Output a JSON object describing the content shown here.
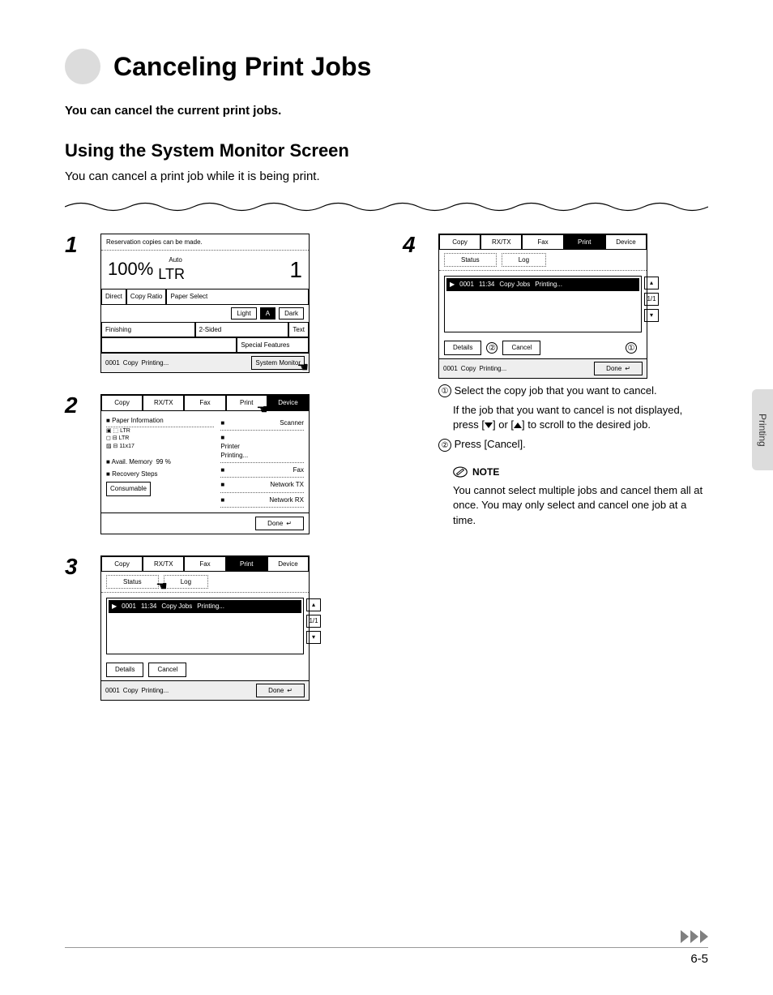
{
  "title": "Canceling Print Jobs",
  "subtitle_bold": "You can cancel the current print jobs.",
  "section_heading": "Using the System Monitor Screen",
  "section_desc": "You can cancel a print job while it is being print.",
  "side_tab": "Printing",
  "page_number": "6-5",
  "steps": {
    "n1": "1",
    "n2": "2",
    "n3": "3",
    "n4": "4"
  },
  "screen1": {
    "topbar": "Reservation copies can be made.",
    "percent": "100%",
    "auto_label": "Auto",
    "ltr": "LTR",
    "one": "1",
    "direct": "Direct",
    "copyratio": "Copy Ratio",
    "paperselect": "Paper Select",
    "light": "Light",
    "a_label": "A",
    "dark": "Dark",
    "finishing": "Finishing",
    "two_sided": "2-Sided",
    "text": "Text",
    "special": "Special Features",
    "status_num": "0001",
    "status_mode": "Copy",
    "status_state": "Printing...",
    "sysmon": "System Monitor"
  },
  "screen2": {
    "tabs": {
      "copy": "Copy",
      "rxtx": "RX/TX",
      "fax": "Fax",
      "print": "Print",
      "device": "Device"
    },
    "paper_info": "Paper Information",
    "paper_lines": {
      "l1": "▣ ⬚ LTR",
      "l2": "◻ ⊟ LTR",
      "l3": "▨ ⊟ 11x17"
    },
    "scanner": "Scanner",
    "printer": "Printer",
    "printer_state": "Printing...",
    "fax": "Fax",
    "avail_mem": "Avail. Memory",
    "avail_pct": "99 %",
    "recovery": "Recovery Steps",
    "net_tx": "Network TX",
    "net_rx": "Network RX",
    "consumable": "Consumable",
    "done": "Done"
  },
  "screen3": {
    "tabs": {
      "copy": "Copy",
      "rxtx": "RX/TX",
      "fax": "Fax",
      "print": "Print",
      "device": "Device"
    },
    "subtabs": {
      "status": "Status",
      "log": "Log"
    },
    "job": {
      "marker": "▶",
      "id": "0001",
      "time": "11:34",
      "type": "Copy Jobs",
      "state": "Printing..."
    },
    "side": {
      "up": "▴",
      "page": "1/1",
      "down": "▾"
    },
    "details": "Details",
    "cancel": "Cancel",
    "status_num": "0001",
    "status_mode": "Copy",
    "status_state": "Printing...",
    "done": "Done"
  },
  "screen4": {
    "tabs": {
      "copy": "Copy",
      "rxtx": "RX/TX",
      "fax": "Fax",
      "print": "Print",
      "device": "Device"
    },
    "subtabs": {
      "status": "Status",
      "log": "Log"
    },
    "job": {
      "marker": "▶",
      "id": "0001",
      "time": "11:34",
      "type": "Copy Jobs",
      "state": "Printing..."
    },
    "side": {
      "up": "▴",
      "page": "1/1",
      "down": "▾"
    },
    "details": "Details",
    "cancel": "Cancel",
    "status_num": "0001",
    "status_mode": "Copy",
    "status_state": "Printing...",
    "done": "Done",
    "callout1": "①",
    "callout2": "②"
  },
  "step4_text": {
    "c1_num": "①",
    "c1": "Select the copy job that you want to cancel.",
    "c1b_a": "If the job that you want to cancel is not displayed, press [",
    "c1b_b": "] or [",
    "c1b_c": "] to scroll to the desired job.",
    "c2_num": "②",
    "c2": "Press [Cancel]."
  },
  "note": {
    "label": "NOTE",
    "text": "You cannot select multiple jobs and cancel them all at once. You may only select and cancel one job at a time."
  }
}
